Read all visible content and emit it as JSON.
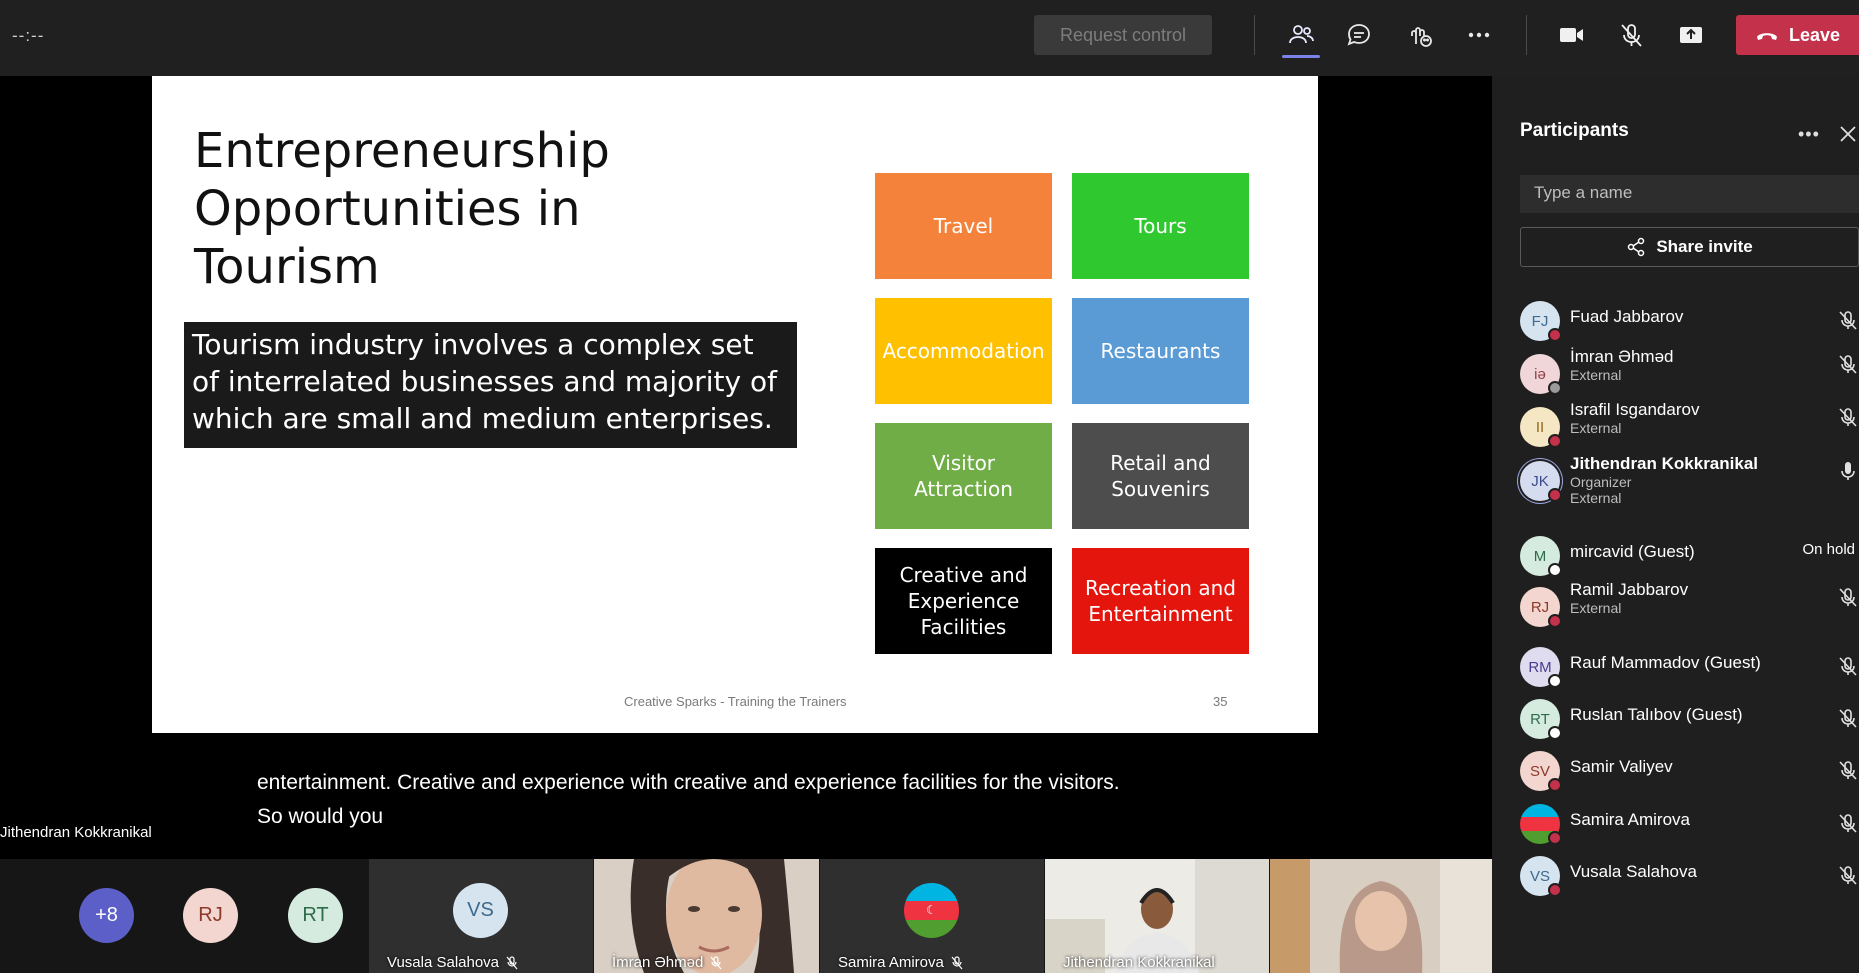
{
  "topbar": {
    "timer": "--:--",
    "request_control": "Request control",
    "leave": "Leave",
    "icons": [
      "people-icon",
      "chat-icon",
      "reactions-icon",
      "more-icon",
      "camera-icon",
      "mic-off-icon",
      "share-tray-icon",
      "phone-hangup-icon"
    ]
  },
  "slide": {
    "title": "Entrepreneurship Opportunities in Tourism",
    "text": "Tourism industry involves a complex set of interrelated businesses and majority of which are small and medium enterprises.",
    "tiles": [
      {
        "label": "Travel",
        "color": "#f5823a"
      },
      {
        "label": "Tours",
        "color": "#2fc92f"
      },
      {
        "label": "Accommodation",
        "color": "#ffc000"
      },
      {
        "label": "Restaurants",
        "color": "#5b9bd5"
      },
      {
        "label": "Visitor Attraction",
        "color": "#70ad47"
      },
      {
        "label": "Retail and Souvenirs",
        "color": "#4d4d4d"
      },
      {
        "label": "Creative and Experience Facilities",
        "color": "#000000"
      },
      {
        "label": "Recreation and Entertainment",
        "color": "#e3150c"
      }
    ],
    "footer": "Creative Sparks - Training the Trainers",
    "page": "35"
  },
  "caption": {
    "line1": "entertainment. Creative and experience with creative and experience facilities for the visitors.",
    "line2": "So would you"
  },
  "presenter_name": "Jithendran Kokkranikal",
  "strip": {
    "overflow": "+8",
    "avatars": [
      {
        "initials": "RJ",
        "color": "#f3d6cf",
        "text_color": "#8b3a2a"
      },
      {
        "initials": "RT",
        "color": "#d5ebdf",
        "text_color": "#2e6b4a"
      }
    ],
    "tiles": [
      {
        "name": "Vusala Salahova",
        "initials": "VS"
      },
      {
        "name": "İmran Əhməd"
      },
      {
        "name": "Samira Amirova"
      },
      {
        "name": "Jithendran Kokkranikal"
      }
    ]
  },
  "participants": {
    "title": "Participants",
    "search_placeholder": "Type a name",
    "share_invite": "Share invite",
    "list": [
      {
        "initials": "FJ",
        "name": "Fuad Jabbarov",
        "sub": "",
        "sub2": "",
        "avatar_color": "#d6e4f0",
        "text_color": "#3d6a8e",
        "status": "#c4314b",
        "mic": "mic-off-icon"
      },
      {
        "initials": "iə",
        "name": "İmran Əhməd",
        "sub": "External",
        "sub2": "",
        "avatar_color": "#f0d6d8",
        "text_color": "#8e3d45",
        "status": "#9a9a9a",
        "mic": "mic-off-icon"
      },
      {
        "initials": "II",
        "name": "Israfil Isgandarov",
        "sub": "External",
        "sub2": "",
        "avatar_color": "#f5e6c4",
        "text_color": "#8e6a1d",
        "status": "#c4314b",
        "mic": "mic-off-icon"
      },
      {
        "initials": "JK",
        "name": "Jithendran Kokkranikal",
        "sub": "Organizer",
        "sub2": "External",
        "avatar_color": "#d6dcf0",
        "text_color": "#3d4a8e",
        "status": "#c4314b",
        "mic": "mic-on-icon",
        "bold": true
      },
      {
        "initials": "M",
        "name": "mircavid (Guest)",
        "sub": "",
        "sub2": "",
        "avatar_color": "#d5ebdf",
        "text_color": "#2e6b4a",
        "status": "#ffffff",
        "onhold": "On hold"
      },
      {
        "initials": "RJ",
        "name": "Ramil Jabbarov",
        "sub": "External",
        "sub2": "",
        "avatar_color": "#f3d6cf",
        "text_color": "#8b3a2a",
        "status": "#c4314b",
        "mic": "mic-off-icon"
      },
      {
        "initials": "RM",
        "name": "Rauf Mammadov (Guest)",
        "sub": "",
        "sub2": "",
        "avatar_color": "#e0dcf0",
        "text_color": "#4a3d8e",
        "status": "#ffffff",
        "mic": "mic-off-icon"
      },
      {
        "initials": "RT",
        "name": "Ruslan Talıbov (Guest)",
        "sub": "",
        "sub2": "",
        "avatar_color": "#d5ebdf",
        "text_color": "#2e6b4a",
        "status": "#ffffff",
        "mic": "mic-off-icon"
      },
      {
        "initials": "SV",
        "name": "Samir Valiyev",
        "sub": "",
        "sub2": "",
        "avatar_color": "#f3d6cf",
        "text_color": "#8b3a2a",
        "status": "#c4314b",
        "mic": "mic-off-icon"
      },
      {
        "initials": "",
        "name": "Samira Amirova",
        "sub": "",
        "sub2": "",
        "avatar_color": "flag",
        "text_color": "#fff",
        "status": "#c4314b",
        "mic": "mic-off-icon"
      },
      {
        "initials": "VS",
        "name": "Vusala Salahova",
        "sub": "",
        "sub2": "",
        "avatar_color": "#d6e4f0",
        "text_color": "#3d6a8e",
        "status": "#c4314b",
        "mic": "mic-off-icon"
      }
    ]
  }
}
